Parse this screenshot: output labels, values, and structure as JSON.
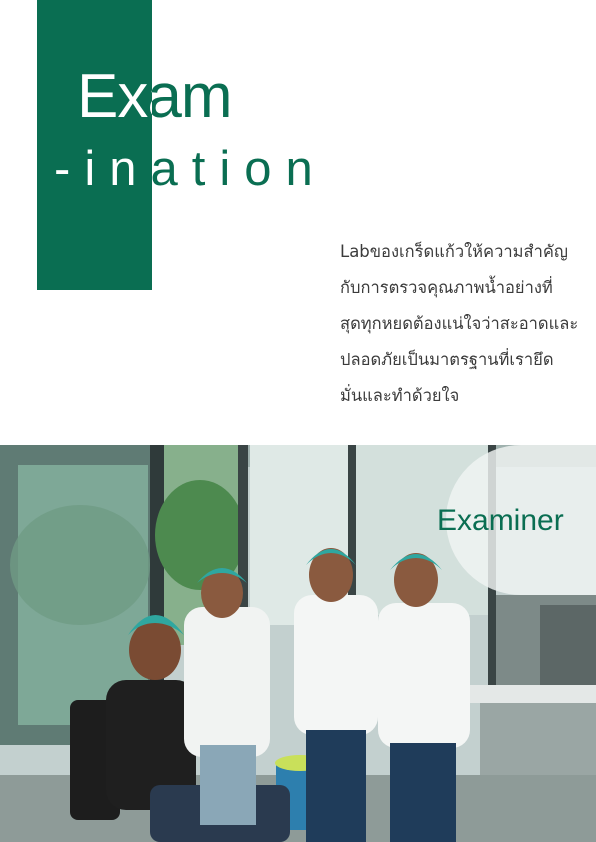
{
  "header": {
    "title_line1": "Exam",
    "title_line2": "-ination"
  },
  "intro": {
    "lines": [
      "Labของเกร็ดแก้วให้ความสำคัญ",
      "กับการตรวจคุณภาพน้ำอย่างที่",
      "สุดทุกหยดต้องแน่ใจว่าสะอาดและ",
      "ปลอดภัยเป็นมาตรฐานที่เรายึด",
      "มั่นและทำด้วยใจ"
    ]
  },
  "photo": {
    "caption": "Examiner",
    "subject": "lab-staff-photo"
  },
  "colors": {
    "brand_green": "#0a6e52",
    "text_dark": "#3b3b3b",
    "hairnet_teal": "#2fa7a0"
  }
}
